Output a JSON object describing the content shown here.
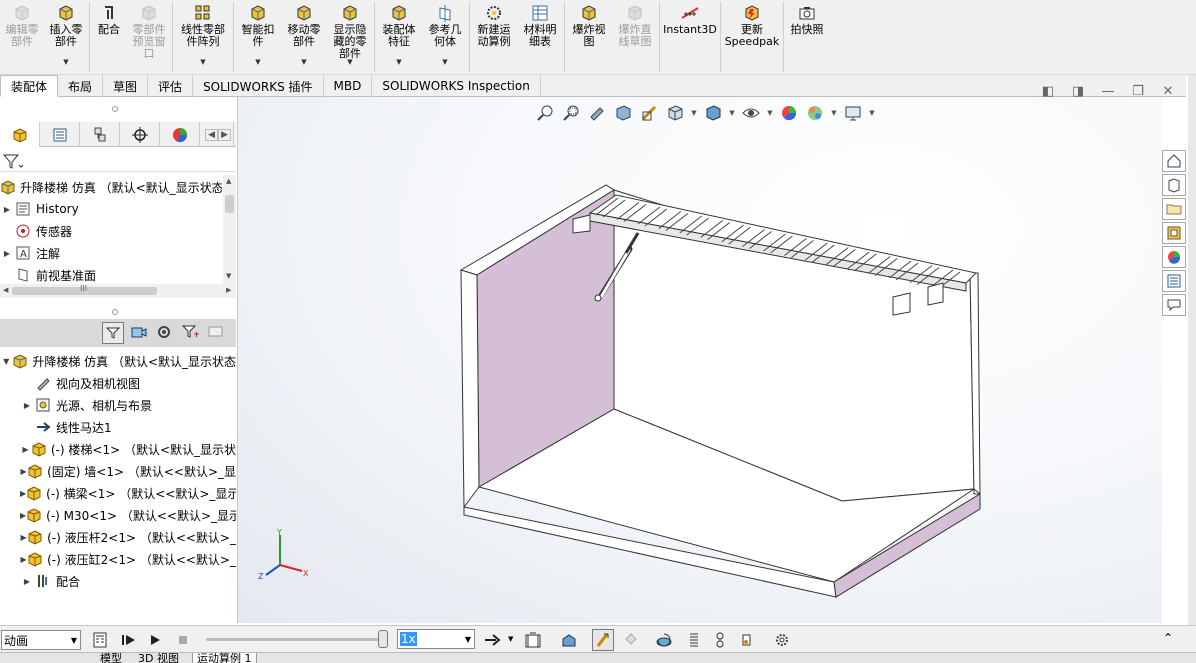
{
  "ribbon": {
    "items": [
      {
        "label": "编辑零\n部件",
        "icon": "edit-component-icon",
        "disabled": true
      },
      {
        "label": "插入零\n部件",
        "icon": "insert-component-icon",
        "disabled": false
      },
      {
        "label": "配合",
        "icon": "mate-icon",
        "disabled": false
      },
      {
        "label": "零部件\n预览窗\n口",
        "icon": "component-preview-icon",
        "disabled": true
      },
      {
        "label": "线性零部\n件阵列",
        "icon": "linear-pattern-icon",
        "disabled": false
      },
      {
        "label": "智能扣\n件",
        "icon": "smart-fasteners-icon",
        "disabled": false
      },
      {
        "label": "移动零\n部件",
        "icon": "move-component-icon",
        "disabled": false
      },
      {
        "label": "显示隐\n藏的零\n部件",
        "icon": "show-hidden-icon",
        "disabled": false
      },
      {
        "label": "装配体\n特征",
        "icon": "assembly-feature-icon",
        "disabled": false
      },
      {
        "label": "参考几\n何体",
        "icon": "reference-geometry-icon",
        "disabled": false
      },
      {
        "label": "新建运\n动算例",
        "icon": "new-motion-study-icon",
        "disabled": false
      },
      {
        "label": "材料明\n细表",
        "icon": "bom-icon",
        "disabled": false
      },
      {
        "label": "爆炸视\n图",
        "icon": "exploded-view-icon",
        "disabled": false
      },
      {
        "label": "爆炸直\n线草图",
        "icon": "explode-line-sketch-icon",
        "disabled": true
      },
      {
        "label": "Instant3D",
        "icon": "instant3d-icon",
        "disabled": false
      },
      {
        "label": "更新\nSpeedpak",
        "icon": "speedpak-icon",
        "disabled": false
      },
      {
        "label": "拍快照",
        "icon": "snapshot-icon",
        "disabled": false
      }
    ]
  },
  "tabs": [
    "装配体",
    "布局",
    "草图",
    "评估",
    "SOLIDWORKS 插件",
    "MBD",
    "SOLIDWORKS Inspection"
  ],
  "feature_tree": {
    "root": "升降楼梯 仿真 （默认<默认_显示状态-",
    "items": [
      "History",
      "传感器",
      "注解",
      "前视基准面"
    ]
  },
  "motion_tree": {
    "root": "升降楼梯 仿真 （默认<默认_显示状态",
    "items": [
      {
        "label": "视向及相机视图",
        "expand": false,
        "icon": "camera-view-icon"
      },
      {
        "label": "光源、相机与布景",
        "expand": true,
        "icon": "lights-scene-icon"
      },
      {
        "label": "线性马达1",
        "expand": false,
        "icon": "linear-motor-icon"
      },
      {
        "label": "(-) 楼梯<1> （默认<默认_显示状",
        "expand": true,
        "icon": "part-icon"
      },
      {
        "label": "(固定) 墙<1> （默认<<默认>_显",
        "expand": true,
        "icon": "part-icon"
      },
      {
        "label": "(-) 横梁<1> （默认<<默认>_显示",
        "expand": true,
        "icon": "part-icon"
      },
      {
        "label": "(-) M30<1> （默认<<默认>_显示",
        "expand": true,
        "icon": "part-icon"
      },
      {
        "label": "(-) 液压杆2<1> （默认<<默认>_",
        "expand": true,
        "icon": "part-icon"
      },
      {
        "label": "(-) 液压缸2<1> （默认<<默认>_",
        "expand": true,
        "icon": "part-icon"
      },
      {
        "label": "配合",
        "expand": true,
        "icon": "mates-icon"
      }
    ]
  },
  "bottom": {
    "study_type": "动画",
    "speed": "1x"
  },
  "status_tabs": [
    "模型",
    "3D 视图",
    "运动算例 1"
  ],
  "triad": {
    "x": "X",
    "y": "Y",
    "z": "Z"
  }
}
